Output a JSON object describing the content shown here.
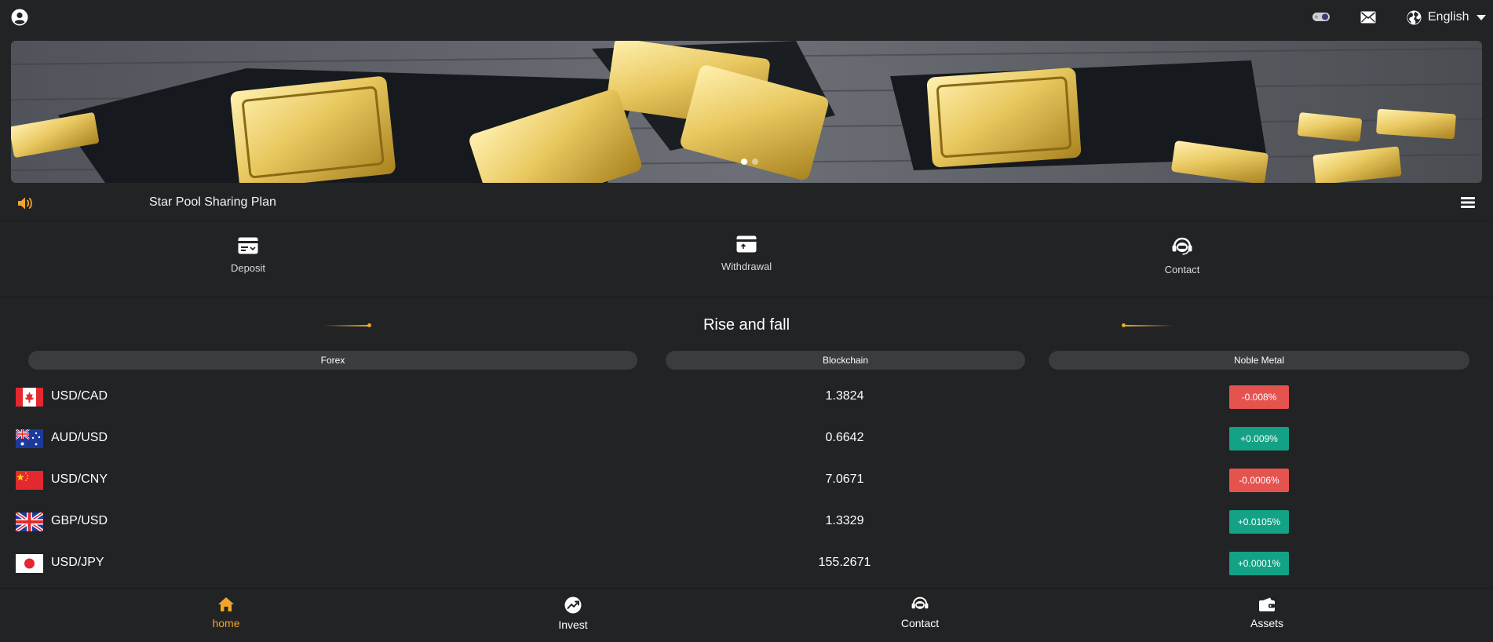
{
  "header": {
    "language": "English",
    "icons": [
      "user-icon",
      "theme-toggle-icon",
      "mail-icon",
      "globe-icon"
    ]
  },
  "colors": {
    "background": "#222325",
    "accent": "#f2a629",
    "rise": "#13a285",
    "fall": "#e5534f",
    "tab_bg": "#3b3c3f"
  },
  "banner": {
    "slide_count": 2,
    "active_slide": 1
  },
  "notice": {
    "text": "Star Pool Sharing Plan"
  },
  "actions": [
    {
      "label": "Deposit",
      "icon": "deposit-card-icon"
    },
    {
      "label": "Withdrawal",
      "icon": "withdrawal-card-icon"
    },
    {
      "label": "Contact",
      "icon": "headset-icon"
    }
  ],
  "market": {
    "title": "Rise and fall",
    "tabs": [
      "Forex",
      "Blockchain",
      "Noble Metal"
    ],
    "rows": [
      {
        "pair": "USD/CAD",
        "flag": "canada",
        "price": "1.3824",
        "change": "-0.008%",
        "direction": "down"
      },
      {
        "pair": "AUD/USD",
        "flag": "australia",
        "price": "0.6642",
        "change": "+0.009%",
        "direction": "up"
      },
      {
        "pair": "USD/CNY",
        "flag": "china",
        "price": "7.0671",
        "change": "-0.0006%",
        "direction": "down"
      },
      {
        "pair": "GBP/USD",
        "flag": "uk",
        "price": "1.3329",
        "change": "+0.0105%",
        "direction": "up"
      },
      {
        "pair": "USD/JPY",
        "flag": "japan",
        "price": "155.2671",
        "change": "+0.0001%",
        "direction": "up"
      }
    ]
  },
  "bottom_nav": [
    {
      "label": "home",
      "icon": "home-icon",
      "active": true
    },
    {
      "label": "Invest",
      "icon": "trend-icon",
      "active": false
    },
    {
      "label": "Contact",
      "icon": "headset-icon",
      "active": false
    },
    {
      "label": "Assets",
      "icon": "wallet-icon",
      "active": false
    }
  ]
}
